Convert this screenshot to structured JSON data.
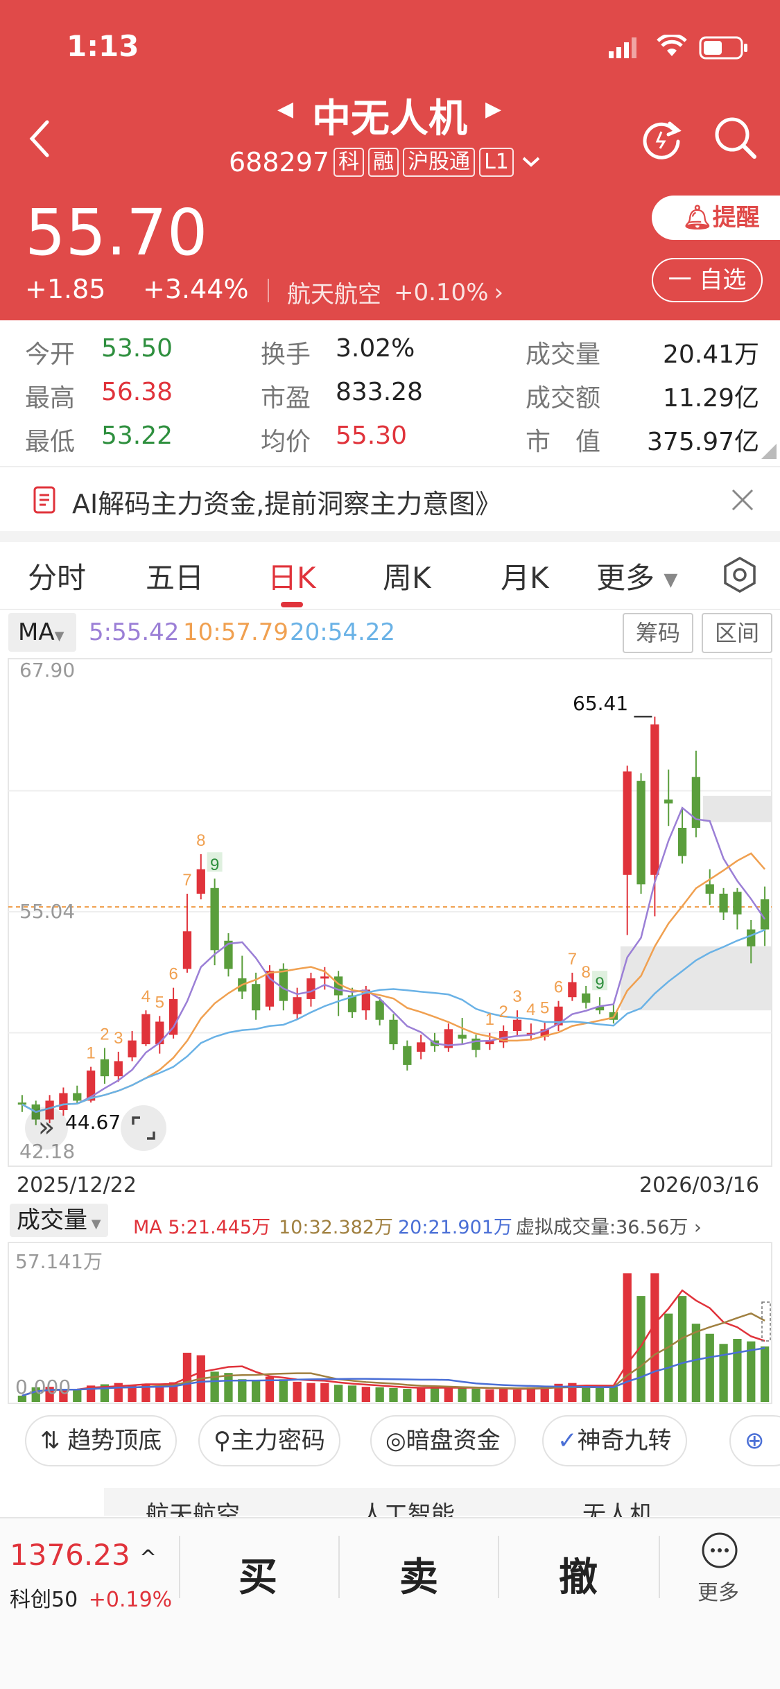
{
  "status": {
    "time": "1:13"
  },
  "header": {
    "stock_name": "中无人机",
    "stock_code": "688297",
    "badges": [
      "科",
      "融",
      "沪股通",
      "L1"
    ],
    "price": "55.70",
    "change": "+1.85",
    "change_pct": "+3.44%",
    "sector": "航天航空",
    "sector_pct": "+0.10%",
    "remind_label": "提醒",
    "watch_label": "一 自选"
  },
  "quote": {
    "open_label": "今开",
    "open": "53.50",
    "high_label": "最高",
    "high": "56.38",
    "low_label": "最低",
    "low": "53.22",
    "turnover_label": "换手",
    "turnover": "3.02%",
    "pe_label": "市盈",
    "pe": "833.28",
    "avg_label": "均价",
    "avg": "55.30",
    "volume_label": "成交量",
    "volume": "20.41万",
    "amount_label": "成交额",
    "amount": "11.29亿",
    "mcap_label": "市　值",
    "mcap": "375.97亿"
  },
  "banner": {
    "text": "AI解码主力资金,提前洞察主力意图》"
  },
  "tabs": [
    "分时",
    "五日",
    "日K",
    "周K",
    "月K",
    "更多"
  ],
  "active_tab": "日K",
  "ma_bar": {
    "label": "MA",
    "ma5": "5:55.42",
    "ma10": "10:57.79",
    "ma20": "20:54.22",
    "btn1": "筹码",
    "btn2": "区间"
  },
  "colors": {
    "up": "#e0333b",
    "down": "#5a9e3c",
    "ma5": "#9b7fd6",
    "ma10": "#f0a050",
    "ma20": "#6ab2e6",
    "header": "#e04a49"
  },
  "kchart": {
    "y_top": "67.90",
    "y_mid": "55.04",
    "y_bottom": "42.18",
    "max_label": "65.41",
    "min_label": "44.67",
    "date_start": "2025/12/22",
    "date_end": "2026/03/16",
    "nine_labels": [
      "1",
      "2",
      "3",
      "4",
      "5",
      "6",
      "7",
      "8",
      "9"
    ]
  },
  "vol_bar": {
    "label": "成交量",
    "ma5": "MA 5:21.445万",
    "ma10": "10:32.382万",
    "ma20": "20:21.901万",
    "virtual": "虚拟成交量:36.56万",
    "y_top": "57.141万",
    "y_bottom": "0.000"
  },
  "chart_data": {
    "type": "candlestick",
    "ylim": [
      42.18,
      67.9
    ],
    "candles": [
      {
        "o": 44.9,
        "c": 44.8,
        "h": 45.3,
        "l": 44.4
      },
      {
        "o": 44.8,
        "c": 44.0,
        "h": 45.0,
        "l": 43.7
      },
      {
        "o": 44.0,
        "c": 45.0,
        "h": 45.3,
        "l": 43.8
      },
      {
        "o": 44.5,
        "c": 45.4,
        "h": 45.7,
        "l": 44.2
      },
      {
        "o": 45.4,
        "c": 45.0,
        "h": 45.8,
        "l": 44.8
      },
      {
        "o": 45.0,
        "c": 46.6,
        "h": 46.8,
        "l": 44.9
      },
      {
        "o": 47.2,
        "c": 46.3,
        "h": 47.8,
        "l": 45.9
      },
      {
        "o": 46.3,
        "c": 47.1,
        "h": 47.6,
        "l": 46.0
      },
      {
        "o": 47.3,
        "c": 48.2,
        "h": 48.7,
        "l": 47.1
      },
      {
        "o": 48.0,
        "c": 49.6,
        "h": 49.8,
        "l": 47.9
      },
      {
        "o": 48.0,
        "c": 49.2,
        "h": 49.5,
        "l": 47.5
      },
      {
        "o": 48.5,
        "c": 50.4,
        "h": 51.0,
        "l": 48.3
      },
      {
        "o": 52.0,
        "c": 54.0,
        "h": 56.0,
        "l": 51.8
      },
      {
        "o": 56.0,
        "c": 57.3,
        "h": 58.1,
        "l": 55.7
      },
      {
        "o": 56.3,
        "c": 53.0,
        "h": 56.8,
        "l": 52.2
      },
      {
        "o": 53.5,
        "c": 52.0,
        "h": 53.9,
        "l": 51.6
      },
      {
        "o": 51.5,
        "c": 50.8,
        "h": 52.7,
        "l": 50.4
      },
      {
        "o": 51.2,
        "c": 49.8,
        "h": 51.8,
        "l": 49.3
      },
      {
        "o": 50.0,
        "c": 51.9,
        "h": 52.2,
        "l": 49.8
      },
      {
        "o": 52.0,
        "c": 50.3,
        "h": 52.3,
        "l": 49.8
      },
      {
        "o": 49.6,
        "c": 50.5,
        "h": 51.0,
        "l": 49.3
      },
      {
        "o": 50.4,
        "c": 51.5,
        "h": 51.8,
        "l": 50.0
      },
      {
        "o": 51.5,
        "c": 51.6,
        "h": 52.1,
        "l": 50.9
      },
      {
        "o": 51.6,
        "c": 50.6,
        "h": 51.9,
        "l": 49.5
      },
      {
        "o": 50.6,
        "c": 49.7,
        "h": 51.0,
        "l": 49.4
      },
      {
        "o": 49.8,
        "c": 50.9,
        "h": 51.1,
        "l": 49.3
      },
      {
        "o": 50.3,
        "c": 49.3,
        "h": 50.5,
        "l": 49.0
      },
      {
        "o": 49.3,
        "c": 48.0,
        "h": 49.6,
        "l": 47.7
      },
      {
        "o": 47.9,
        "c": 46.9,
        "h": 48.2,
        "l": 46.6
      },
      {
        "o": 47.6,
        "c": 48.1,
        "h": 48.5,
        "l": 47.2
      },
      {
        "o": 48.2,
        "c": 47.9,
        "h": 48.6,
        "l": 47.6
      },
      {
        "o": 47.8,
        "c": 48.8,
        "h": 49.1,
        "l": 47.6
      },
      {
        "o": 48.5,
        "c": 48.3,
        "h": 49.4,
        "l": 48.0
      },
      {
        "o": 48.3,
        "c": 47.7,
        "h": 48.5,
        "l": 47.3
      },
      {
        "o": 48.0,
        "c": 48.2,
        "h": 48.6,
        "l": 47.7
      },
      {
        "o": 48.1,
        "c": 48.7,
        "h": 49.0,
        "l": 47.8
      },
      {
        "o": 48.7,
        "c": 49.3,
        "h": 49.8,
        "l": 48.4
      },
      {
        "o": 48.5,
        "c": 48.6,
        "h": 49.1,
        "l": 48.2
      },
      {
        "o": 48.4,
        "c": 48.8,
        "h": 49.2,
        "l": 48.2
      },
      {
        "o": 49.0,
        "c": 50.0,
        "h": 50.3,
        "l": 48.7
      },
      {
        "o": 50.5,
        "c": 51.3,
        "h": 51.8,
        "l": 50.3
      },
      {
        "o": 50.7,
        "c": 50.2,
        "h": 51.1,
        "l": 49.9
      },
      {
        "o": 50.0,
        "c": 49.8,
        "h": 50.5,
        "l": 49.6
      },
      {
        "o": 49.7,
        "c": 49.3,
        "h": 50.1,
        "l": 49.1
      },
      {
        "o": 57.0,
        "c": 62.5,
        "h": 62.8,
        "l": 53.8
      },
      {
        "o": 62.0,
        "c": 56.5,
        "h": 62.4,
        "l": 56.0
      },
      {
        "o": 57.0,
        "c": 65.0,
        "h": 65.41,
        "l": 54.8
      },
      {
        "o": 61.0,
        "c": 60.8,
        "h": 62.6,
        "l": 59.6
      },
      {
        "o": 59.5,
        "c": 58.0,
        "h": 60.6,
        "l": 57.6
      },
      {
        "o": 62.2,
        "c": 59.5,
        "h": 63.6,
        "l": 59.0
      },
      {
        "o": 56.5,
        "c": 56.0,
        "h": 57.3,
        "l": 55.4
      },
      {
        "o": 56.0,
        "c": 55.0,
        "h": 56.3,
        "l": 54.6
      },
      {
        "o": 56.1,
        "c": 54.9,
        "h": 56.3,
        "l": 54.1
      },
      {
        "o": 54.1,
        "c": 53.2,
        "h": 54.6,
        "l": 52.3
      },
      {
        "o": 55.7,
        "c": 54.1,
        "h": 56.38,
        "l": 53.22
      }
    ],
    "nine_positions": [
      5,
      6,
      7,
      9,
      10,
      11,
      12,
      13,
      14,
      34,
      35,
      36,
      37,
      38,
      39,
      40,
      41,
      42
    ],
    "volume": {
      "ylim": [
        0,
        57.141
      ],
      "values": [
        2.5,
        5.8,
        6.0,
        5.0,
        5.2,
        6.5,
        7.0,
        7.5,
        6.8,
        7.2,
        6.5,
        7.8,
        19.5,
        18.5,
        12.0,
        11.5,
        9.0,
        8.5,
        10.0,
        9.0,
        8.0,
        7.5,
        7.5,
        6.8,
        6.5,
        6.0,
        5.8,
        5.5,
        5.2,
        5.5,
        6.2,
        5.8,
        5.5,
        5.3,
        5.0,
        5.2,
        4.8,
        5.8,
        6.2,
        7.2,
        7.5,
        6.0,
        5.5,
        6.0,
        51.0,
        42.0,
        51.0,
        35.0,
        42.0,
        31.0,
        27.0,
        23.0,
        25.0,
        24.0,
        22.0
      ]
    }
  },
  "indicators": [
    "趋势顶底",
    "主力密码",
    "暗盘资金",
    "神奇九转"
  ],
  "bottom": {
    "index_value": "1376.23",
    "index_name": "科创50",
    "index_pct": "+0.19%",
    "buy": "买",
    "sell": "卖",
    "cancel": "撤",
    "more": "更多"
  },
  "sub_tabs": [
    "航天航空",
    "人工智能",
    "无人机"
  ]
}
